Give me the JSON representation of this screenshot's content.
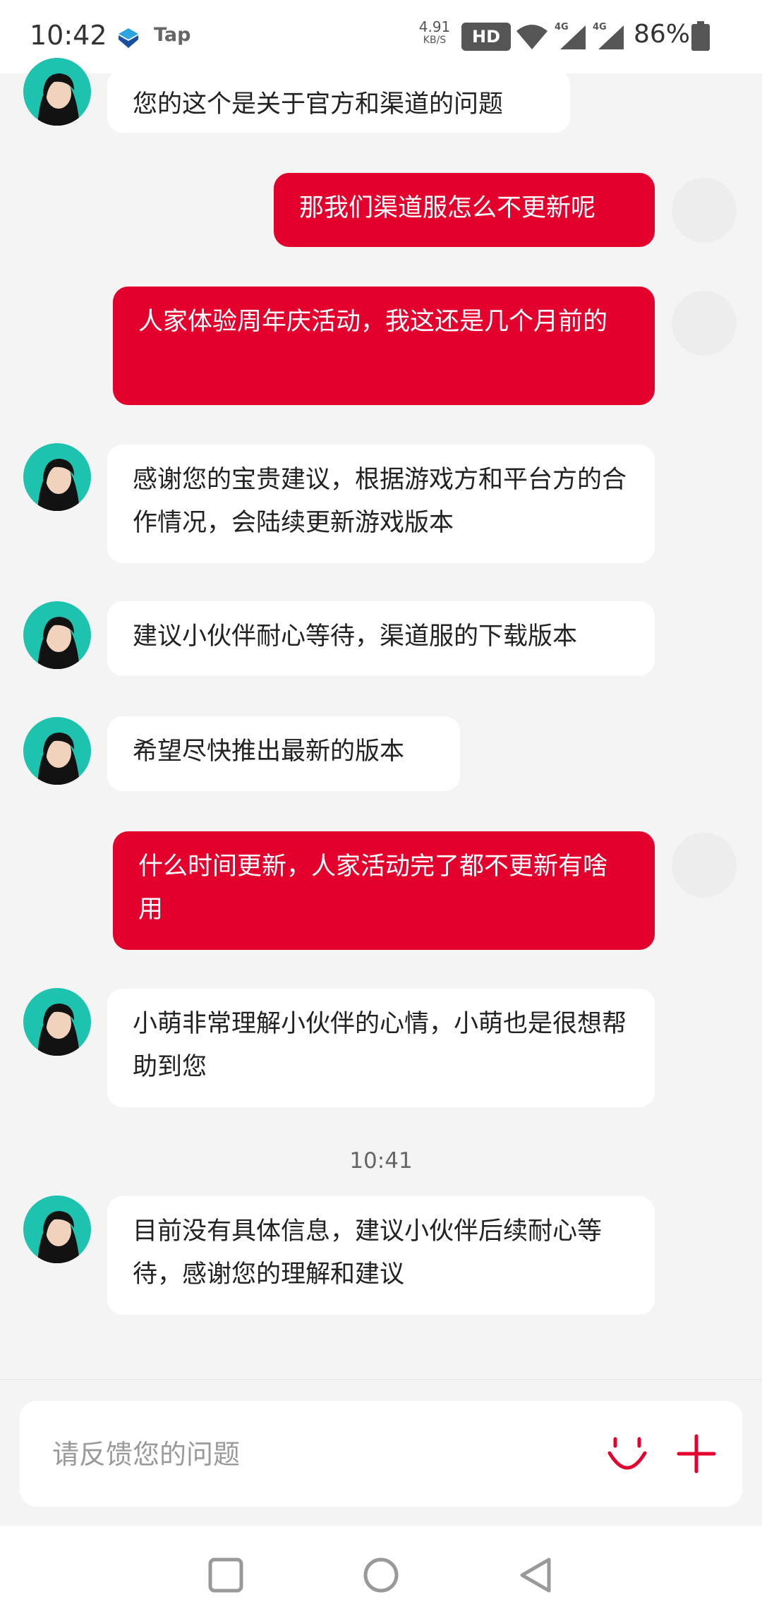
{
  "status_bar": {
    "time": "10:42",
    "app_icon_2_label": "Tap",
    "net_speed_value": "4.91",
    "net_speed_unit": "KB/S",
    "hd_label": "HD",
    "battery_percent": "86%"
  },
  "chat": {
    "messages": [
      {
        "from": "agent",
        "text": "您的这个是关于官方和渠道的问题"
      },
      {
        "from": "user",
        "text": "那我们渠道服怎么不更新呢"
      },
      {
        "from": "user",
        "text": "人家体验周年庆活动，我这还是几个月前的"
      },
      {
        "from": "agent",
        "text": "感谢您的宝贵建议，根据游戏方和平台方的合作情况，会陆续更新游戏版本"
      },
      {
        "from": "agent",
        "text": "建议小伙伴耐心等待，渠道服的下载版本"
      },
      {
        "from": "agent",
        "text": "希望尽快推出最新的版本"
      },
      {
        "from": "user",
        "text": "什么时间更新，人家活动完了都不更新有啥用"
      },
      {
        "from": "agent",
        "text": "小萌非常理解小伙伴的心情，小萌也是很想帮助到您"
      },
      {
        "from": "agent",
        "text": "目前没有具体信息，建议小伙伴后续耐心等待，感谢您的理解和建议"
      }
    ],
    "timestamp": "10:41"
  },
  "input": {
    "placeholder": "请反馈您的问题",
    "value": ""
  },
  "icons": {
    "emoji": "smile-icon",
    "add": "plus-icon",
    "nav_recent": "square-icon",
    "nav_home": "circle-icon",
    "nav_back": "triangle-back-icon"
  },
  "colors": {
    "accent": "#e3002c",
    "agent_avatar_bg": "#1ec3b0",
    "background": "#f4f4f4"
  }
}
